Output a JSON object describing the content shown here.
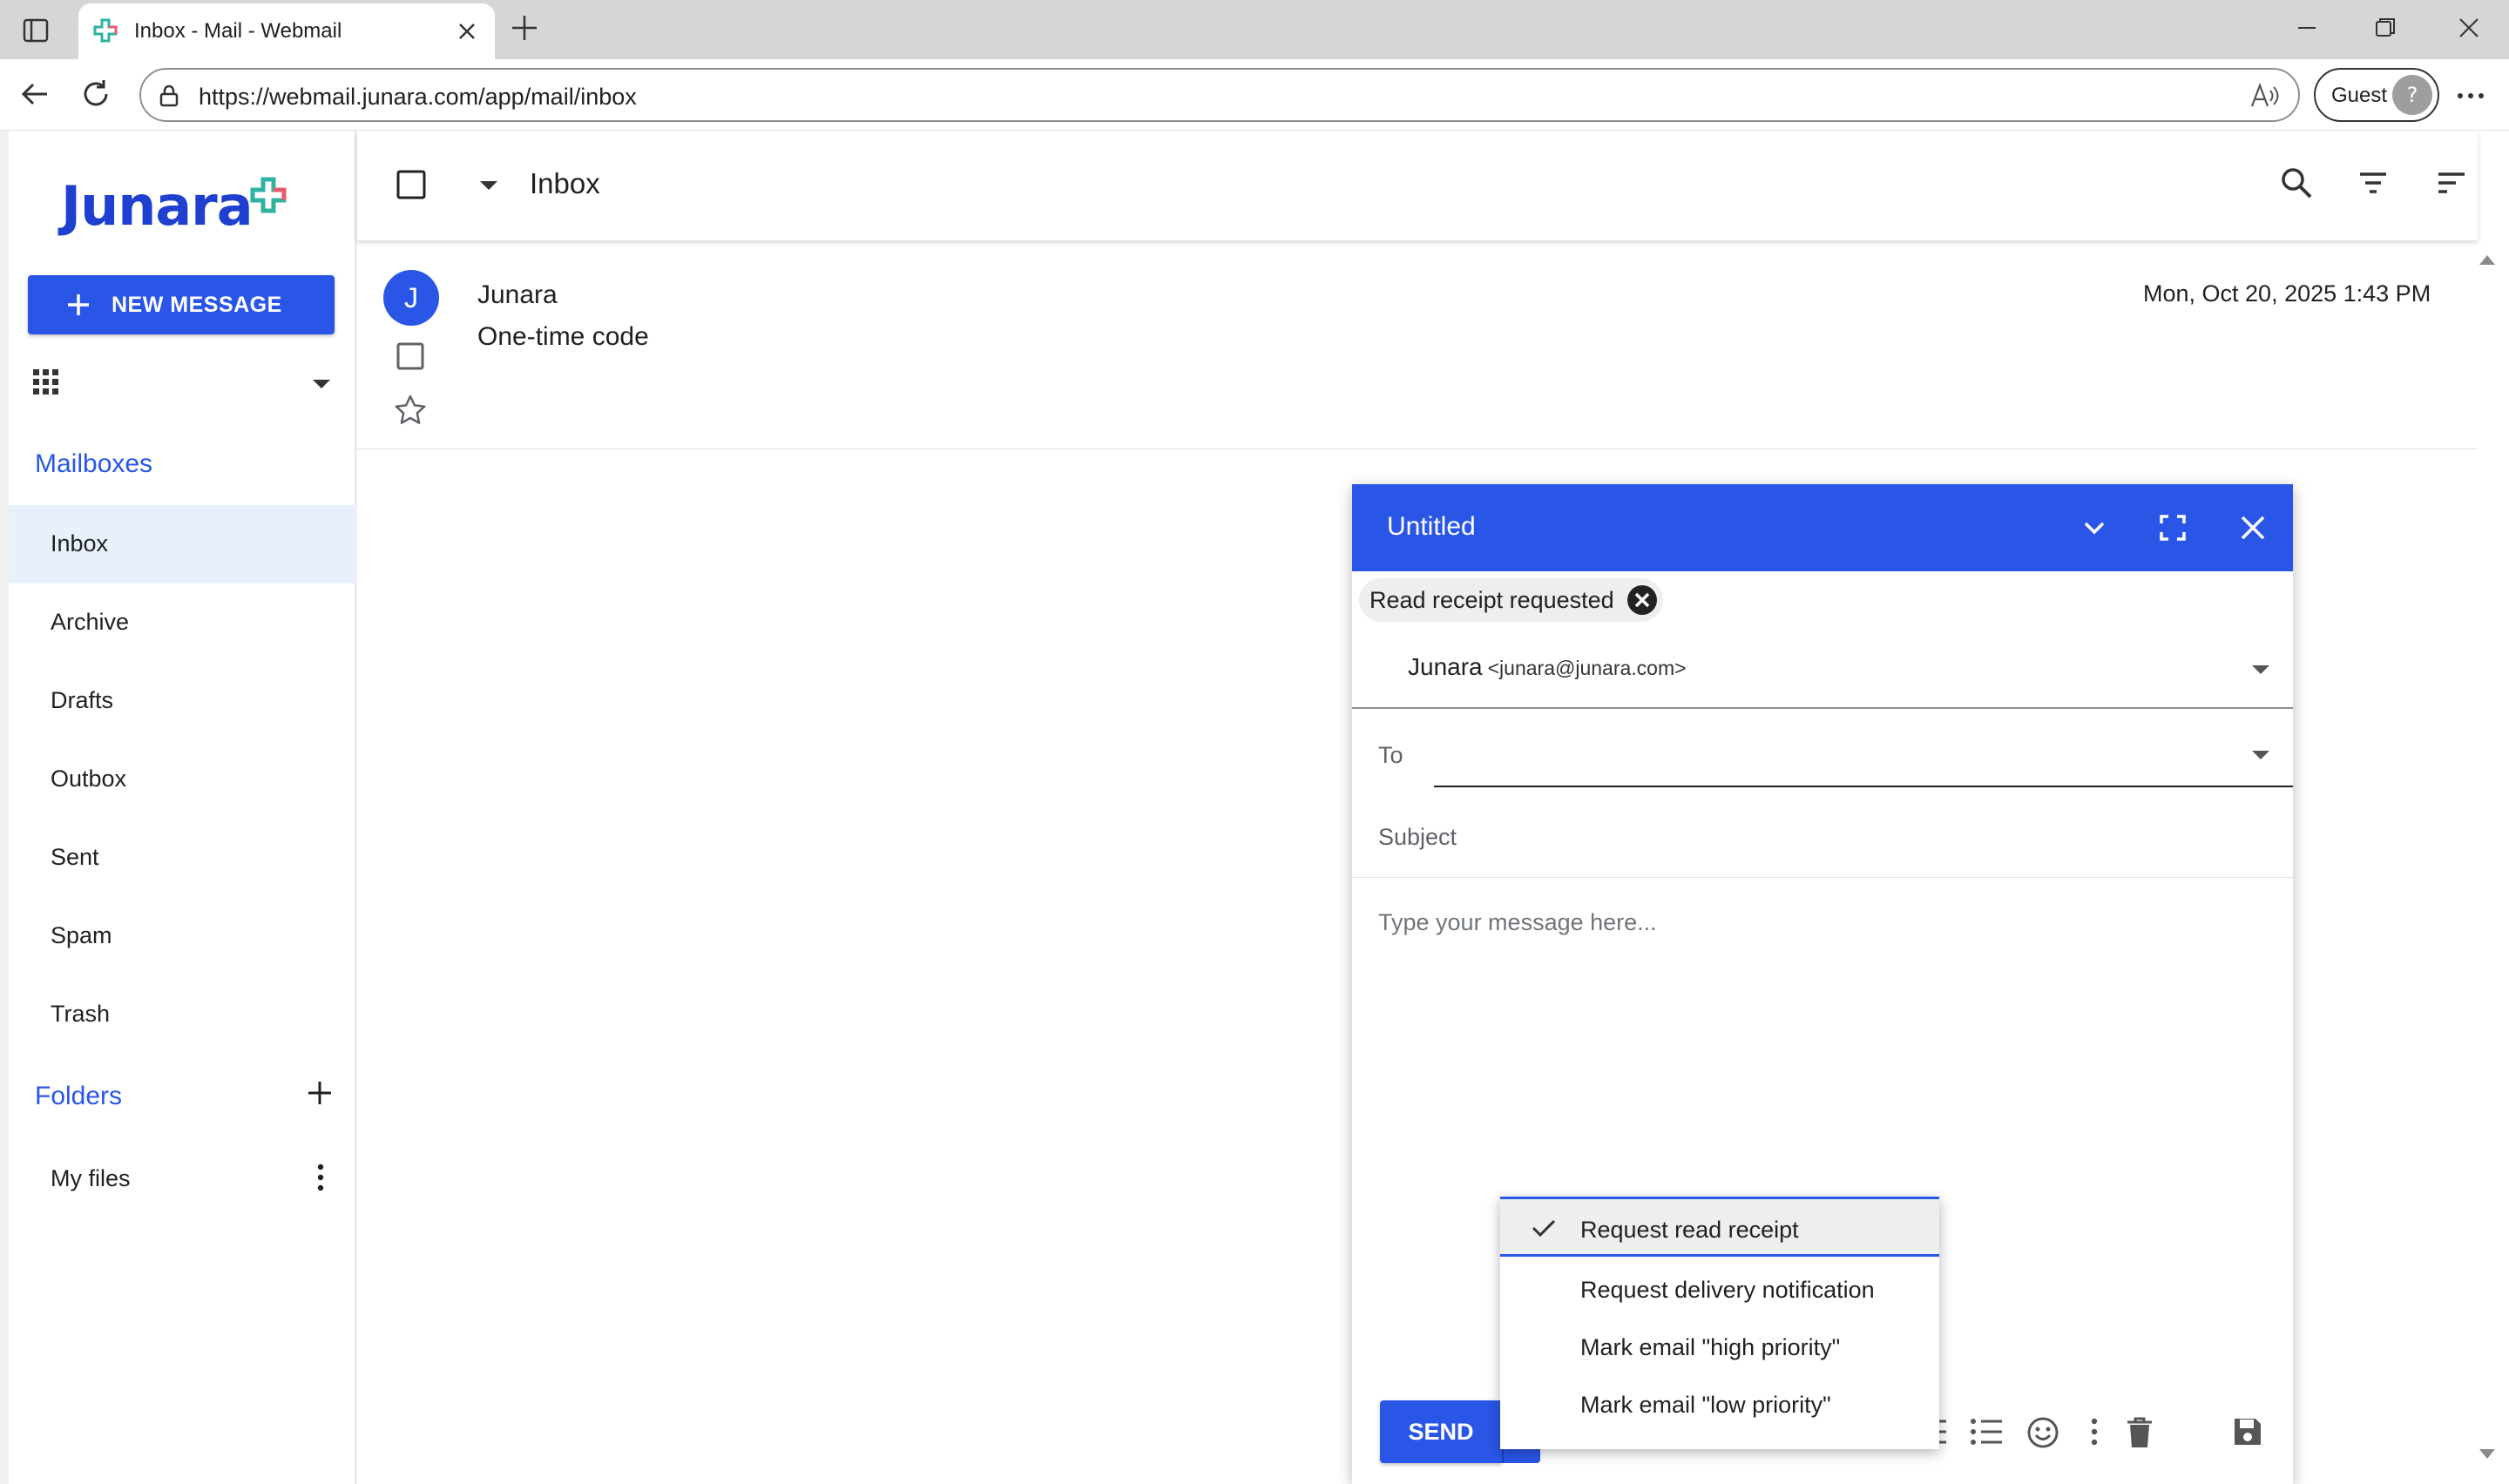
{
  "browser": {
    "tab_title": "Inbox - Mail - Webmail",
    "url": "https://webmail.junara.com/app/mail/inbox",
    "profile_label": "Guest"
  },
  "sidebar": {
    "logo_text": "Junara",
    "new_message_label": "NEW MESSAGE",
    "mailboxes_heading": "Mailboxes",
    "mailboxes": [
      {
        "label": "Inbox",
        "active": true
      },
      {
        "label": "Archive"
      },
      {
        "label": "Drafts"
      },
      {
        "label": "Outbox"
      },
      {
        "label": "Sent"
      },
      {
        "label": "Spam"
      },
      {
        "label": "Trash"
      }
    ],
    "folders_heading": "Folders",
    "folders": [
      {
        "label": "My files"
      }
    ]
  },
  "list": {
    "title": "Inbox",
    "messages": [
      {
        "avatar_initial": "J",
        "sender": "Junara",
        "subject": "One-time code",
        "date": "Mon, Oct 20, 2025 1:43 PM"
      }
    ]
  },
  "compose": {
    "title": "Untitled",
    "chip_label": "Read receipt requested",
    "from_name": "Junara",
    "from_email": "<junara@junara.com>",
    "to_label": "To",
    "subject_label": "Subject",
    "body_placeholder": "Type your message here...",
    "send_label": "SEND"
  },
  "send_menu": {
    "items": [
      {
        "label": "Request read receipt",
        "checked": true
      },
      {
        "label": "Request delivery notification"
      },
      {
        "label": "Mark email \"high priority\""
      },
      {
        "label": "Mark email \"low priority\""
      }
    ]
  },
  "colors": {
    "accent": "#2a56e8",
    "logo_blue": "#1f3fcf",
    "active_item_bg": "#e8f1fb"
  }
}
